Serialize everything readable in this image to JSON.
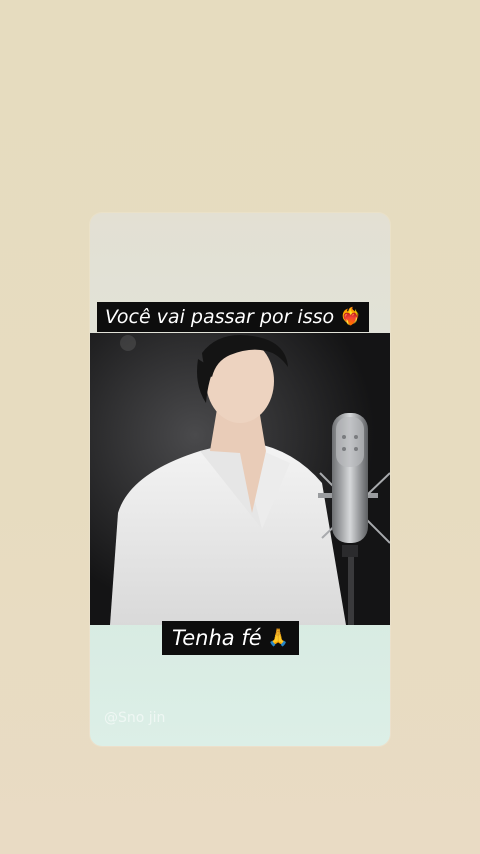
{
  "story": {
    "caption_top": "Você vai passar por isso",
    "caption_top_emoji": "❤️‍🔥",
    "caption_bottom": "Tenha fé",
    "caption_bottom_emoji": "🙏",
    "watermark": "@Sno jin"
  },
  "colors": {
    "background": "#e6dcbf",
    "caption_background": "#0d0d0d",
    "caption_text": "#ffffff"
  },
  "icons": {
    "heart_on_fire": "heart-on-fire-icon",
    "praying_hands": "praying-hands-icon"
  }
}
